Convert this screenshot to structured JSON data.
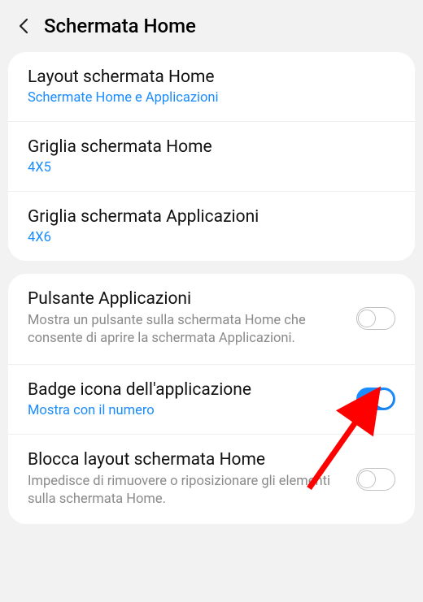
{
  "header": {
    "title": "Schermata Home"
  },
  "card1": {
    "row1": {
      "title": "Layout schermata Home",
      "subtitle": "Schermate Home e Applicazioni"
    },
    "row2": {
      "title": "Griglia schermata Home",
      "subtitle": "4X5"
    },
    "row3": {
      "title": "Griglia schermata Applicazioni",
      "subtitle": "4X6"
    }
  },
  "card2": {
    "row1": {
      "title": "Pulsante Applicazioni",
      "description": "Mostra un pulsante sulla schermata Home che consente di aprire la schermata Applicazioni.",
      "toggle": false
    },
    "row2": {
      "title": "Badge icona dell'applicazione",
      "subtitle": "Mostra con il numero",
      "toggle": true
    },
    "row3": {
      "title": "Blocca layout schermata Home",
      "description": "Impedisce di rimuovere o riposizionare gli elementi sulla schermata Home.",
      "toggle": false
    }
  },
  "colors": {
    "accent": "#1a8cff",
    "arrow": "#ff0000"
  }
}
